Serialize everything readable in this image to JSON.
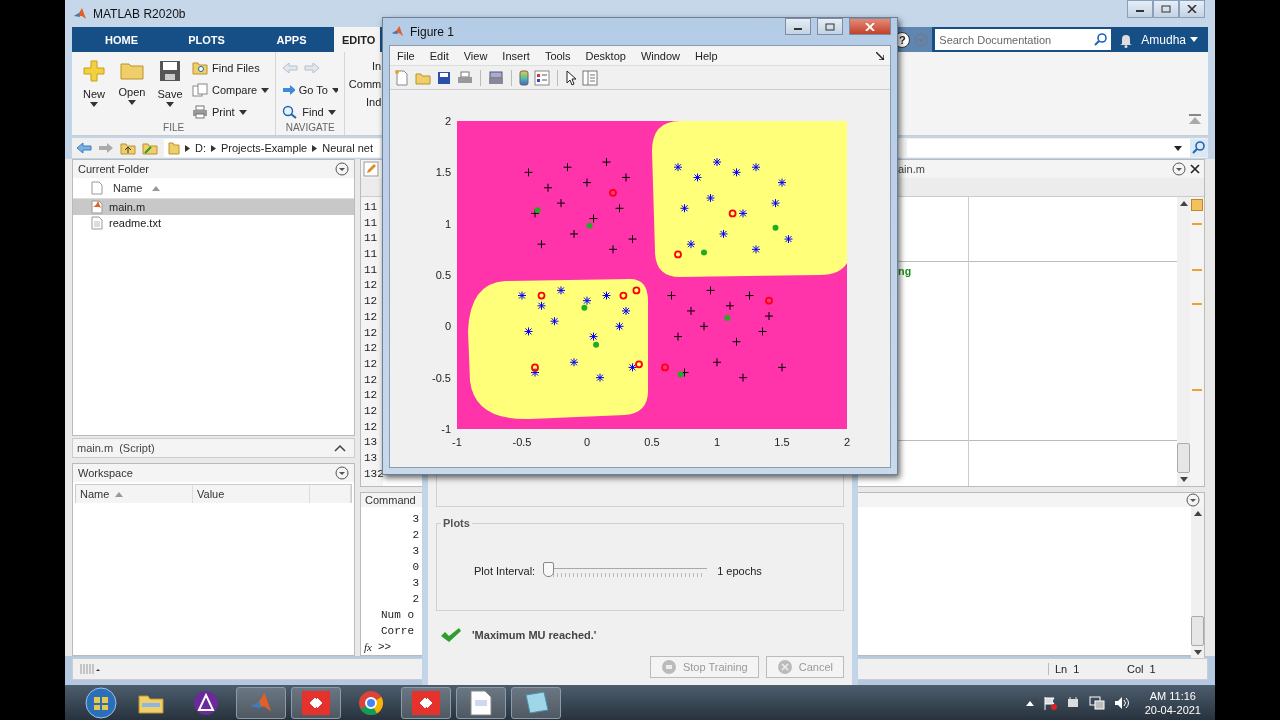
{
  "matlab_window": {
    "title": "MATLAB R2020b"
  },
  "ribbon": {
    "tabs": [
      {
        "label": "HOME",
        "selected": false
      },
      {
        "label": "PLOTS",
        "selected": false
      },
      {
        "label": "APPS",
        "selected": false
      },
      {
        "label": "EDITO",
        "selected": true
      }
    ],
    "help_label": "?",
    "search": {
      "placeholder": "Search Documentation"
    },
    "user": "Amudha"
  },
  "toolstrip": {
    "file": {
      "label": "FILE",
      "large": [
        {
          "label": "New",
          "dropdown": true
        },
        {
          "label": "Open",
          "dropdown": true
        },
        {
          "label": "Save",
          "dropdown": true
        }
      ],
      "small": [
        {
          "label": "Find Files",
          "dropdown": false
        },
        {
          "label": "Compare",
          "dropdown": true
        },
        {
          "label": "Print",
          "dropdown": true
        }
      ]
    },
    "navigate": {
      "label": "NAVIGATE",
      "small": [
        {
          "label": "Go To",
          "dropdown": true
        },
        {
          "label": "Find",
          "dropdown": true
        }
      ]
    },
    "cut_labels": [
      "In",
      "Comm",
      "Ind"
    ]
  },
  "address_bar": {
    "path": [
      "D:",
      "Projects-Example",
      "Neural net"
    ]
  },
  "current_folder": {
    "title": "Current Folder",
    "column": "Name",
    "files": [
      {
        "name": "main.m",
        "kind": "script",
        "selected": true
      },
      {
        "name": "readme.txt",
        "kind": "text",
        "selected": false
      }
    ],
    "details": "main.m  (Script)"
  },
  "workspace": {
    "title": "Workspace",
    "columns": [
      "Name",
      "Value"
    ]
  },
  "editor": {
    "tab": "ain.m",
    "line_numbers": [
      "11",
      "11",
      "11",
      "11",
      "11",
      "12",
      "12",
      "12",
      "12",
      "12",
      "12",
      "12",
      "12",
      "12",
      "12",
      "13",
      "13",
      "132"
    ],
    "code_fragment": "ng"
  },
  "command_window": {
    "title": "Command",
    "lines": [
      "3",
      "2",
      "3",
      "0",
      "3",
      "2",
      "Num o",
      "Corre"
    ],
    "function_label": "fx",
    "prompt": ">>"
  },
  "status_bar": {
    "line": "Ln  1",
    "column": "Col  1"
  },
  "figure": {
    "title": "Figure 1",
    "menu": [
      "File",
      "Edit",
      "View",
      "Insert",
      "Tools",
      "Desktop",
      "Window",
      "Help"
    ],
    "chart_data": {
      "type": "scatter",
      "xlim": [
        -1,
        2
      ],
      "ylim": [
        -1,
        2
      ],
      "xticks": [
        -1,
        -0.5,
        0,
        0.5,
        1,
        1.5,
        2
      ],
      "yticks": [
        -1,
        -0.5,
        0,
        0.5,
        1,
        1.5,
        2
      ],
      "series": [
        {
          "color": "#000000",
          "x": [
            -0.45,
            -0.3,
            -0.15,
            0.0,
            0.15,
            0.3,
            -0.4,
            -0.2,
            0.05,
            0.25,
            -0.35,
            -0.1,
            0.2,
            0.35,
            0.65,
            0.8,
            0.95,
            1.1,
            1.25,
            1.4,
            0.7,
            0.9,
            1.15,
            1.35,
            0.75,
            1.0,
            1.2,
            1.5
          ],
          "values": [
            1.5,
            1.35,
            1.55,
            1.4,
            1.6,
            1.45,
            1.1,
            1.2,
            1.05,
            1.15,
            0.8,
            0.9,
            0.75,
            0.85,
            0.3,
            0.15,
            0.35,
            0.2,
            0.3,
            0.1,
            -0.1,
            0.0,
            -0.15,
            -0.05,
            -0.45,
            -0.35,
            -0.5,
            -0.4
          ]
        },
        {
          "color": "#0000ff",
          "x": [
            0.7,
            0.85,
            1.0,
            1.15,
            1.3,
            1.5,
            0.75,
            0.95,
            1.2,
            1.45,
            0.8,
            1.05,
            1.3,
            1.55,
            -0.5,
            -0.35,
            -0.2,
            0.0,
            0.15,
            0.3,
            -0.45,
            -0.25,
            0.05,
            0.25,
            -0.4,
            -0.1,
            0.1,
            0.35
          ],
          "values": [
            1.55,
            1.45,
            1.6,
            1.5,
            1.55,
            1.4,
            1.15,
            1.25,
            1.1,
            1.2,
            0.8,
            0.9,
            0.75,
            0.85,
            0.3,
            0.2,
            0.35,
            0.25,
            0.3,
            0.15,
            -0.05,
            0.05,
            -0.1,
            0.0,
            -0.45,
            -0.35,
            -0.5,
            -0.4
          ]
        },
        {
          "color": "#ff0000",
          "x": [
            0.2,
            1.12,
            0.7,
            -0.35,
            0.28,
            0.38,
            -0.4,
            0.4,
            0.6,
            1.4
          ],
          "values": [
            1.3,
            1.1,
            0.7,
            0.3,
            0.3,
            0.35,
            -0.4,
            -0.37,
            -0.4,
            0.25
          ]
        },
        {
          "color": "#22aa22",
          "x": [
            -0.38,
            0.02,
            1.45,
            0.9,
            -0.02,
            0.07,
            0.72,
            1.08
          ],
          "values": [
            1.13,
            0.98,
            0.96,
            0.72,
            0.18,
            -0.18,
            -0.47,
            0.08
          ]
        }
      ]
    }
  },
  "training_dialog": {
    "plots_title": "Plots",
    "plot_interval": {
      "label": "Plot Interval:",
      "level": 0,
      "reading": "1 epochs"
    },
    "message": "'Maximum MU reached.'",
    "buttons": [
      {
        "label": "Stop Training",
        "disabled": true
      },
      {
        "label": "Cancel",
        "disabled": true
      }
    ]
  },
  "taskbar": {
    "apps": [
      {
        "kind": "explorer",
        "running": false
      },
      {
        "kind": "triangle-app",
        "running": false
      },
      {
        "kind": "matlab",
        "running": true
      },
      {
        "kind": "remote-desktop",
        "running": true
      },
      {
        "kind": "browser",
        "running": false
      },
      {
        "kind": "remote-desktop",
        "running": true
      },
      {
        "kind": "document",
        "running": true
      },
      {
        "kind": "notes",
        "running": true
      }
    ],
    "time": "AM 11:16",
    "date": "20-04-2021"
  }
}
